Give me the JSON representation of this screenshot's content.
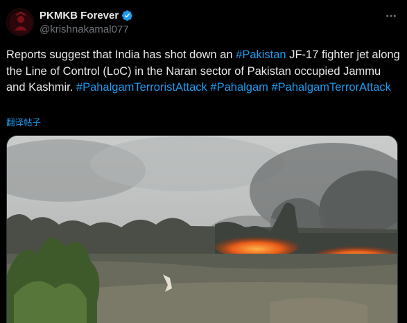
{
  "post": {
    "author": {
      "display_name": "PKMKB Forever",
      "handle": "@krishnakamal077",
      "verified": true,
      "avatar_icon": "dark-red-figure-avatar"
    },
    "text_segments": [
      {
        "type": "text",
        "text": "Reports suggest that India has shot down an "
      },
      {
        "type": "hashtag",
        "text": "#Pakistan"
      },
      {
        "type": "text",
        "text": " JF-17 fighter jet along the Line of Control (LoC) in the Naran sector of Pakistan occupied Jammu and Kashmir. "
      },
      {
        "type": "hashtag",
        "text": "#PahalgamTerroristAttack"
      },
      {
        "type": "text",
        "text": " "
      },
      {
        "type": "hashtag",
        "text": "#Pahalgam"
      },
      {
        "type": "text",
        "text": " "
      },
      {
        "type": "hashtag",
        "text": "#PahalgamTerrorAttack"
      }
    ],
    "translate_label": "翻译帖子",
    "media_description_icon": "video-frame-field-fire-smoke"
  },
  "colors": {
    "background": "#000000",
    "text": "#e7e9ea",
    "secondary_text": "#71767b",
    "link": "#1d9bf0",
    "verified": "#1d9bf0"
  }
}
